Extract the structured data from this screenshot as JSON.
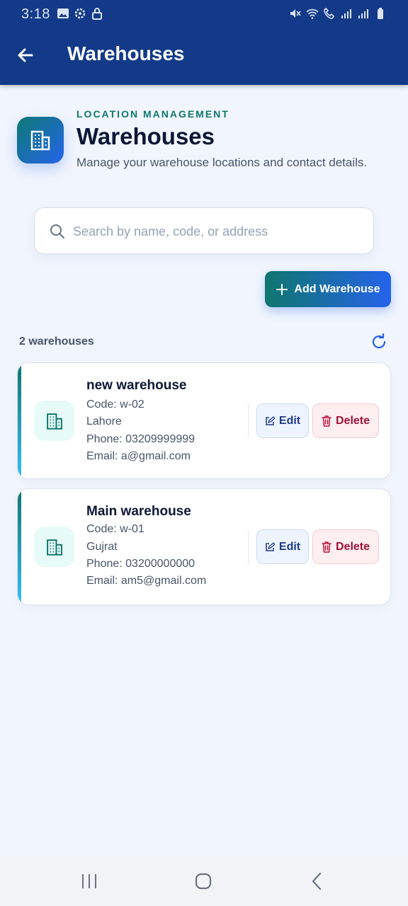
{
  "status_bar": {
    "time": "3:18"
  },
  "app_bar": {
    "title": "Warehouses"
  },
  "hero": {
    "eyebrow": "LOCATION MANAGEMENT",
    "title": "Warehouses",
    "subtitle": "Manage your warehouse locations and contact details."
  },
  "search": {
    "placeholder": "Search by name, code, or address",
    "value": ""
  },
  "add_button": {
    "label": "Add Warehouse"
  },
  "list": {
    "count_label": "2 warehouses",
    "items": [
      {
        "name": "new warehouse",
        "code": "Code: w-02",
        "address": "Lahore",
        "phone": "Phone: 03209999999",
        "email": "Email: a@gmail.com",
        "edit_label": "Edit",
        "delete_label": "Delete"
      },
      {
        "name": "Main warehouse",
        "code": "Code: w-01",
        "address": "Gujrat",
        "phone": "Phone: 03200000000",
        "email": "Email: am5@gmail.com",
        "edit_label": "Edit",
        "delete_label": "Delete"
      }
    ]
  },
  "colors": {
    "app_bar": "#133a88",
    "accent_teal": "#0f766e",
    "accent_blue": "#2563eb",
    "delete_red": "#9f1239"
  },
  "icons": {
    "back": "arrow-left-icon",
    "hero": "building-icon",
    "search": "search-icon",
    "add": "plus-icon",
    "refresh": "refresh-icon",
    "edit": "edit-icon",
    "delete": "trash-icon"
  }
}
